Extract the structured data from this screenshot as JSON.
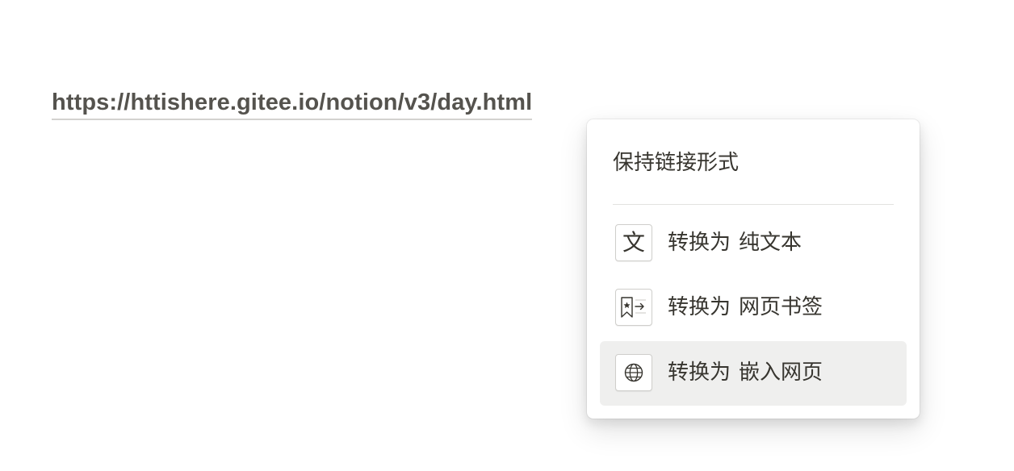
{
  "editor": {
    "link_text": "https://httishere.gitee.io/notion/v3/day.html"
  },
  "paste_menu": {
    "keep_link_label": "保持链接形式",
    "items": [
      {
        "prefix": "转换为",
        "target": "纯文本",
        "icon": "text-icon",
        "icon_glyph": "文",
        "hovered": false
      },
      {
        "prefix": "转换为",
        "target": "网页书签",
        "icon": "bookmark-icon",
        "hovered": false
      },
      {
        "prefix": "转换为",
        "target": "嵌入网页",
        "icon": "globe-icon",
        "hovered": true
      }
    ]
  },
  "colors": {
    "text": "#37352f",
    "link": "#55534e",
    "hover_background": "#efefee"
  }
}
